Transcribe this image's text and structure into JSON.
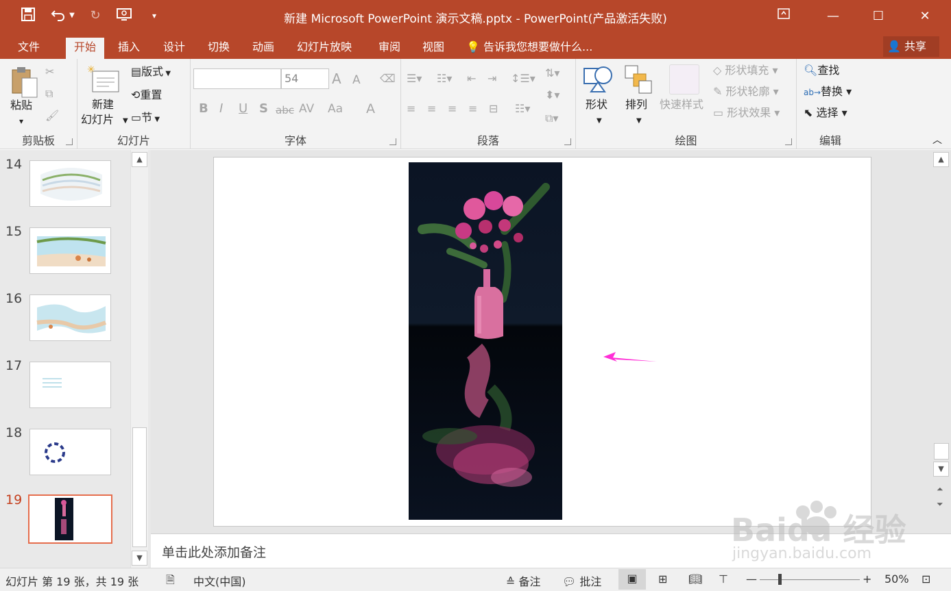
{
  "window": {
    "title": "新建 Microsoft PowerPoint 演示文稿.pptx - PowerPoint(产品激活失败)",
    "share_label": "共享"
  },
  "ribbon_tabs": [
    {
      "label": "文件"
    },
    {
      "label": "开始"
    },
    {
      "label": "插入"
    },
    {
      "label": "设计"
    },
    {
      "label": "切换"
    },
    {
      "label": "动画"
    },
    {
      "label": "幻灯片放映"
    },
    {
      "label": "审阅"
    },
    {
      "label": "视图"
    }
  ],
  "tell_me": "告诉我您想要做什么...",
  "clipboard": {
    "paste": "粘贴",
    "group": "剪贴板"
  },
  "slides_group": {
    "new_slide_line1": "新建",
    "new_slide_line2": "幻灯片",
    "layout": "版式",
    "reset": "重置",
    "section": "节",
    "group": "幻灯片"
  },
  "font_group": {
    "font_size": "54",
    "bold": "B",
    "italic": "I",
    "underline": "U",
    "shadow": "S",
    "strike": "abc",
    "spacing": "AV",
    "case": "Aa",
    "color": "A",
    "grow": "A",
    "shrink": "A",
    "group": "字体"
  },
  "paragraph_group": {
    "group": "段落"
  },
  "drawing_group": {
    "shapes": "形状",
    "arrange": "排列",
    "quick_styles": "快速样式",
    "fill": "形状填充",
    "outline": "形状轮廓",
    "effects": "形状效果",
    "group": "绘图"
  },
  "editing_group": {
    "find": "查找",
    "replace": "替换",
    "select": "选择",
    "group": "编辑"
  },
  "thumbnails": [
    {
      "number": "14"
    },
    {
      "number": "15"
    },
    {
      "number": "16"
    },
    {
      "number": "17"
    },
    {
      "number": "18"
    },
    {
      "number": "19"
    }
  ],
  "notes_placeholder": "单击此处添加备注",
  "status": {
    "slide_info": "幻灯片 第 19 张，共 19 张",
    "language": "中文(中国)",
    "notes": "备注",
    "comments": "批注",
    "zoom": "50%"
  },
  "watermark": {
    "text": "Baidu 经验",
    "url": "jingyan.baidu.com"
  },
  "colors": {
    "accent": "#b7472a",
    "selected_thumb_border": "#e56d4c",
    "arrow": "#ff2fd6"
  }
}
